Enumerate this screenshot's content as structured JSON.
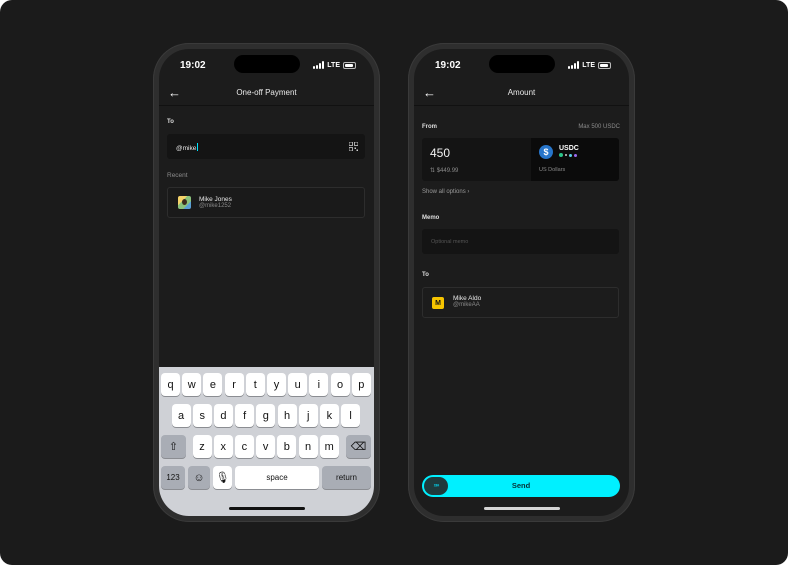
{
  "left_phone": {
    "status": {
      "time": "19:02",
      "network": "LTE"
    },
    "nav": {
      "title": "One-off Payment"
    },
    "to": {
      "label": "To",
      "input_value": "@mike"
    },
    "recent": {
      "label": "Recent",
      "items": [
        {
          "name": "Mike Jones",
          "handle": "@mike1252"
        }
      ]
    },
    "keyboard": {
      "row1": [
        "q",
        "w",
        "e",
        "r",
        "t",
        "y",
        "u",
        "i",
        "o",
        "p"
      ],
      "row2": [
        "a",
        "s",
        "d",
        "f",
        "g",
        "h",
        "j",
        "k",
        "l"
      ],
      "row3": [
        "z",
        "x",
        "c",
        "v",
        "b",
        "n",
        "m"
      ],
      "mode_label": "123",
      "space_label": "space",
      "return_label": "return",
      "shift_icon": "⇧",
      "delete_icon": "⌫",
      "emoji_icon": "☺",
      "mic_icon": "🎙"
    }
  },
  "right_phone": {
    "status": {
      "time": "19:02",
      "network": "LTE"
    },
    "nav": {
      "title": "Amount"
    },
    "from": {
      "label": "From",
      "max_label": "Max 500 USDC",
      "amount": "450",
      "usd_value": "⇅ $449.99",
      "asset_symbol": "USDC",
      "asset_icon": "$",
      "asset_subtitle": "US Dollars",
      "show_options": "Show all options ›"
    },
    "memo": {
      "label": "Memo",
      "placeholder": "Optional memo"
    },
    "to": {
      "label": "To",
      "name": "Mike Aldo",
      "handle": "@mikeAA",
      "badge": "M"
    },
    "send": {
      "label": "Send",
      "knob_icon": "»»"
    }
  },
  "colors": {
    "background": "#1b1b1b",
    "screen": "#1c1c1c",
    "accent_cyan": "#00f0ff",
    "usdc_blue": "#2775ca",
    "badge_yellow": "#f6c400"
  }
}
